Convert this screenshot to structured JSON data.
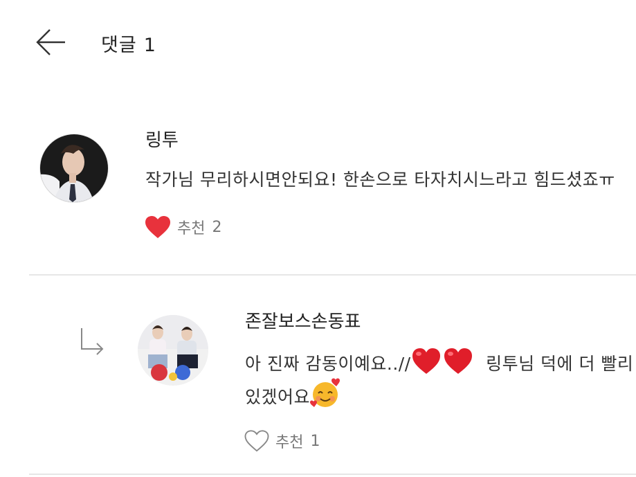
{
  "header": {
    "title": "댓글",
    "count": "1"
  },
  "comments": [
    {
      "author": "링투",
      "text": "작가님 무리하시면안되요! 한손으로 타자치시느라고 힘드셨죠ㅠ",
      "like_label": "추천",
      "like_count": "2",
      "liked": true
    }
  ],
  "replies": [
    {
      "author": "존잘보스손동표",
      "text_part1": "아 진짜 감동이예요..//",
      "text_part2": "링투님 덕에 더 빨리",
      "text_line2": "있겠어요",
      "like_label": "추천",
      "like_count": "1",
      "liked": false
    }
  ],
  "colors": {
    "heart_red": "#e8323c",
    "divider": "#e6e6e6",
    "muted_text": "#777777"
  },
  "icons": {
    "back": "arrow-left-icon",
    "reply": "reply-arrow-icon",
    "heart_filled": "heart-filled-icon",
    "heart_outline": "heart-outline-icon"
  }
}
